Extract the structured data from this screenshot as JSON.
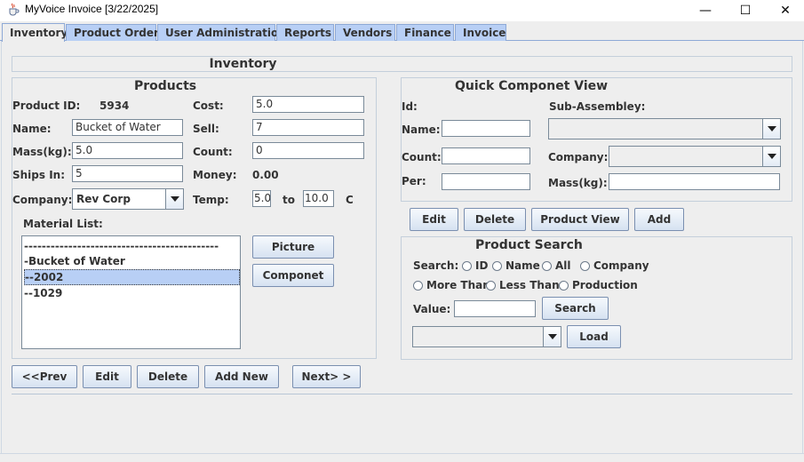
{
  "window": {
    "title": "MyVoice Invoice  [3/22/2025]",
    "icon": "java-cup-icon",
    "controls": {
      "minimize": "—",
      "maximize": "☐",
      "close": "✕"
    }
  },
  "tabs": [
    {
      "label": "Inventory",
      "active": true
    },
    {
      "label": "Product Order"
    },
    {
      "label": "User Administration"
    },
    {
      "label": "Reports"
    },
    {
      "label": "Vendors"
    },
    {
      "label": "Finance"
    },
    {
      "label": "Invoice"
    }
  ],
  "page_title": "Inventory",
  "products": {
    "heading": "Products",
    "product_id_label": "Product ID:",
    "product_id_value": "5934",
    "cost_label": "Cost:",
    "cost_value": "5.0",
    "name_label": "Name:",
    "name_value": "Bucket of Water",
    "sell_label": "Sell:",
    "sell_value": "7",
    "mass_label": "Mass(kg):",
    "mass_value": "5.0",
    "count_label": "Count:",
    "count_value": "0",
    "ships_label": "Ships In:",
    "ships_value": "5",
    "money_label": "Money:",
    "money_value": "0.00",
    "company_label": "Company:",
    "company_value": "Rev Corp",
    "temp_label": "Temp:",
    "temp_min": "5.0",
    "temp_to": "to",
    "temp_max": "10.0",
    "temp_unit": "C",
    "material_label": "Material List:",
    "material_items": [
      "--------------------------------------------",
      "-Bucket of Water",
      "--2002",
      "--1029"
    ],
    "selected_material_index": 2,
    "picture_button": "Picture",
    "componet_button": "Componet"
  },
  "nav_buttons": {
    "prev": "<<Prev",
    "edit": "Edit",
    "delete": "Delete",
    "add_new": "Add New",
    "next": "Next> >"
  },
  "quick_view": {
    "heading": "Quick Componet View",
    "id_label": "Id:",
    "sub_assembley_label": "Sub-Assembley:",
    "name_label": "Name:",
    "name_value": "",
    "count_label": "Count:",
    "count_value": "",
    "company_label": "Company:",
    "per_label": "Per:",
    "per_value": "",
    "mass_label": "Mass(kg):",
    "mass_value": "",
    "edit_button": "Edit",
    "delete_button": "Delete",
    "product_view_button": "Product View",
    "add_button": "Add"
  },
  "search": {
    "heading": "Product Search",
    "search_label": "Search:",
    "options_row1": [
      "ID",
      "Name",
      "All",
      "Company"
    ],
    "options_row2": [
      "More Than",
      "Less Than",
      "Production"
    ],
    "value_label": "Value:",
    "value_input": "",
    "search_button": "Search",
    "load_button": "Load",
    "results_selected": ""
  }
}
